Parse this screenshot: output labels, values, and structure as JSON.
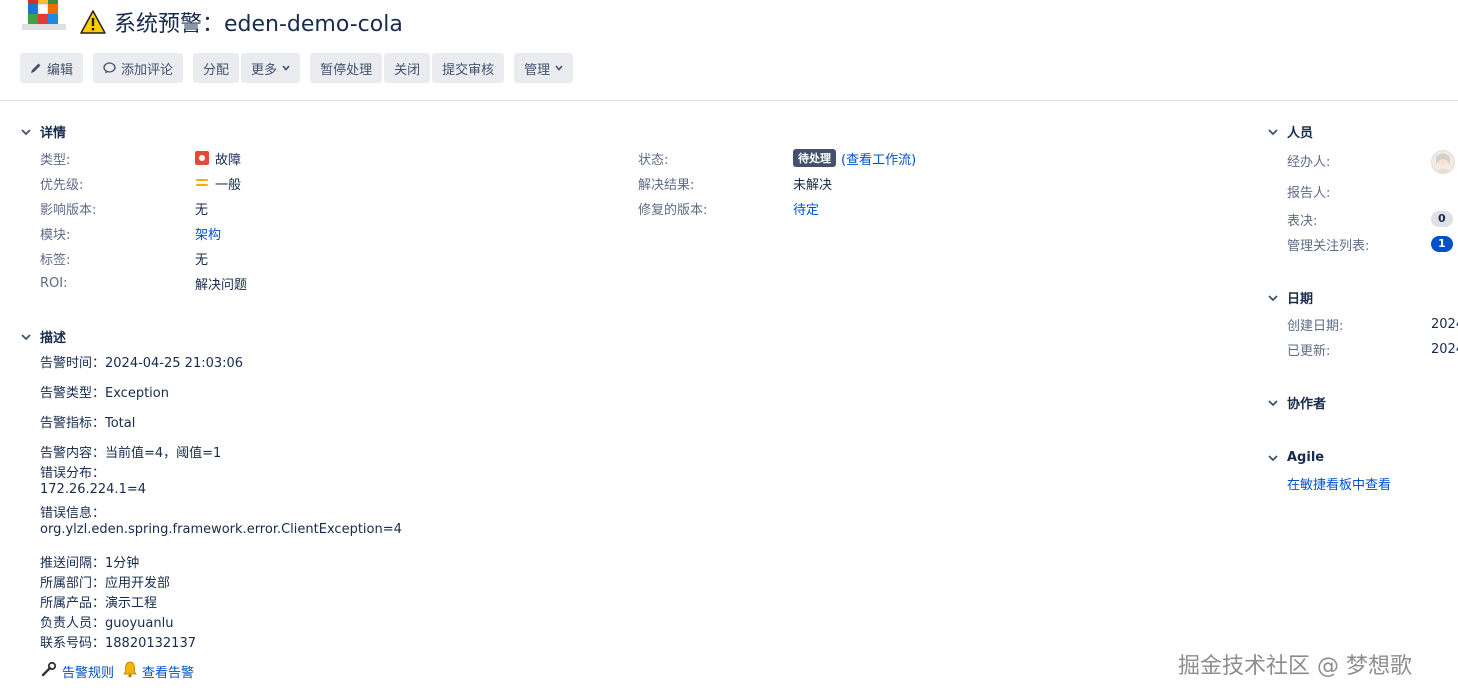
{
  "header": {
    "title": "系统预警：eden-demo-cola"
  },
  "toolbar": {
    "edit": "编辑",
    "comment": "添加评论",
    "assign": "分配",
    "more": "更多",
    "pause": "暂停处理",
    "close": "关闭",
    "submit_review": "提交审核",
    "manage": "管理"
  },
  "details": {
    "heading": "详情",
    "fields": {
      "type_label": "类型:",
      "type_value": "故障",
      "priority_label": "优先级:",
      "priority_value": "一般",
      "affects_label": "影响版本:",
      "affects_value": "无",
      "module_label": "模块:",
      "module_value": "架构",
      "labels_label": "标签:",
      "labels_value": "无",
      "roi_label": "ROI:",
      "roi_value": "解决问题",
      "status_label": "状态:",
      "status_value": "待处理",
      "status_link": "(查看工作流)",
      "resolution_label": "解决结果:",
      "resolution_value": "未解决",
      "fix_label": "修复的版本:",
      "fix_value": "待定"
    }
  },
  "description": {
    "heading": "描述",
    "lines": [
      "告警时间：2024-04-25 21:03:06",
      "告警类型：Exception",
      "告警指标：Total",
      "告警内容：当前值=4，阈值=1",
      "错误分布：",
      "172.26.224.1=4",
      "错误信息：",
      "org.ylzl.eden.spring.framework.error.ClientException=4",
      "推送间隔：1分钟",
      "所属部门：应用开发部",
      "所属产品：演示工程",
      "负责人员：guoyuanlu",
      "联系号码：18820132137"
    ],
    "rule_link": "告警规则",
    "view_link": "查看告警"
  },
  "people": {
    "heading": "人员",
    "assignee_label": "经办人:",
    "reporter_label": "报告人:",
    "votes_label": "表决:",
    "votes_count": "0",
    "watchers_label": "管理关注列表:",
    "watchers_count": "1"
  },
  "dates": {
    "heading": "日期",
    "created_label": "创建日期:",
    "created_value": "2024",
    "updated_label": "已更新:",
    "updated_value": "2024"
  },
  "collaborators": {
    "heading": "协作者"
  },
  "agile": {
    "heading": "Agile",
    "link": "在敏捷看板中查看"
  },
  "watermark": "掘金技术社区 @ 梦想歌",
  "colors": {
    "link": "#0052cc",
    "bug": "#e5493a",
    "priority": "#ffab00",
    "button_bg": "#ebecf0"
  }
}
